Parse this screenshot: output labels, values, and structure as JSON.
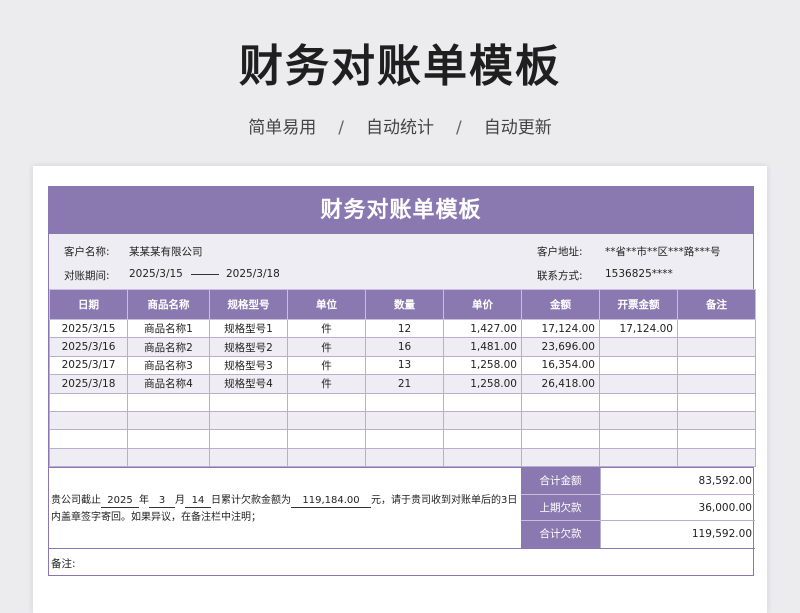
{
  "hero": {
    "title": "财务对账单模板",
    "tags": [
      "简单易用",
      "自动统计",
      "自动更新"
    ],
    "separator": "/"
  },
  "sheet": {
    "banner": "财务对账单模板",
    "info": {
      "customer_label": "客户名称:",
      "customer_value": "某某某有限公司",
      "period_label": "对账期间:",
      "period_start": "2025/3/15",
      "period_end": "2025/3/18",
      "address_label": "客户地址:",
      "address_value": "**省**市**区***路***号",
      "contact_label": "联系方式:",
      "contact_value": "1536825****"
    },
    "columns": [
      "日期",
      "商品名称",
      "规格型号",
      "单位",
      "数量",
      "单价",
      "金额",
      "开票金额",
      "备注"
    ],
    "rows": [
      [
        "2025/3/15",
        "商品名称1",
        "规格型号1",
        "件",
        "12",
        "1,427.00",
        "17,124.00",
        "17,124.00",
        ""
      ],
      [
        "2025/3/16",
        "商品名称2",
        "规格型号2",
        "件",
        "16",
        "1,481.00",
        "23,696.00",
        "",
        ""
      ],
      [
        "2025/3/17",
        "商品名称3",
        "规格型号3",
        "件",
        "13",
        "1,258.00",
        "16,354.00",
        "",
        ""
      ],
      [
        "2025/3/18",
        "商品名称4",
        "规格型号4",
        "件",
        "21",
        "1,258.00",
        "26,418.00",
        "",
        ""
      ],
      [
        "",
        "",
        "",
        "",
        "",
        "",
        "",
        "",
        ""
      ],
      [
        "",
        "",
        "",
        "",
        "",
        "",
        "",
        "",
        ""
      ],
      [
        "",
        "",
        "",
        "",
        "",
        "",
        "",
        "",
        ""
      ],
      [
        "",
        "",
        "",
        "",
        "",
        "",
        "",
        "",
        ""
      ]
    ],
    "statement": {
      "p1": "贵公司截止",
      "year": "2025",
      "p2": "年",
      "month": "3",
      "p3": "月",
      "day": "14",
      "p4": "日累计欠款金额为",
      "amount": "119,184.00",
      "p5": "元，请于贵司收到对账单后的3日内盖章签字寄回。如果异议，在备注栏中注明；"
    },
    "summary": [
      {
        "label": "合计金额",
        "value": "83,592.00"
      },
      {
        "label": "上期欠款",
        "value": "36,000.00"
      },
      {
        "label": "合计欠款",
        "value": "119,592.00"
      }
    ],
    "remark_label": "备注:"
  },
  "colors": {
    "accent": "#8a79b1",
    "stripe": "#efedf4",
    "background": "#ececef"
  }
}
